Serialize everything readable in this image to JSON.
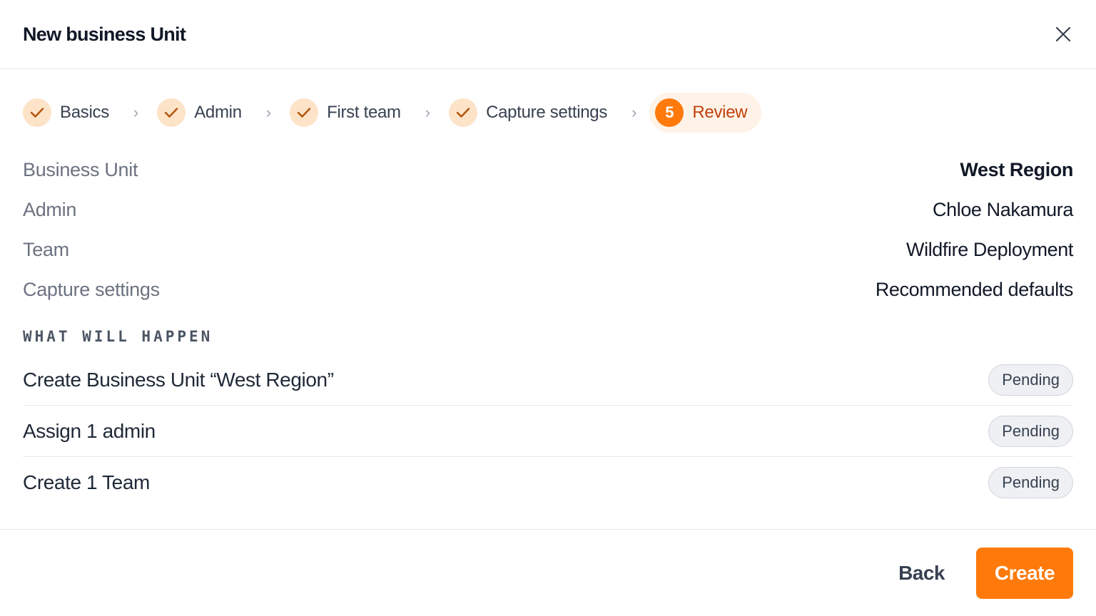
{
  "modal": {
    "title": "New business Unit",
    "close_icon": "close-icon"
  },
  "stepper": {
    "steps": [
      {
        "label": "Basics",
        "status": "complete",
        "icon": "check-icon"
      },
      {
        "label": "Admin",
        "status": "complete",
        "icon": "check-icon"
      },
      {
        "label": "First team",
        "status": "complete",
        "icon": "check-icon"
      },
      {
        "label": "Capture settings",
        "status": "complete",
        "icon": "check-icon"
      },
      {
        "label": "Review",
        "status": "active",
        "number": "5"
      }
    ],
    "separator": "›"
  },
  "summary": {
    "rows": [
      {
        "key": "Business Unit",
        "value": "West Region"
      },
      {
        "key": "Admin",
        "value": "Chloe Nakamura"
      },
      {
        "key": "Team",
        "value": "Wildfire Deployment"
      },
      {
        "key": "Capture settings",
        "value": "Recommended defaults"
      }
    ]
  },
  "what_will_happen": {
    "title": "WHAT WILL HAPPEN",
    "items": [
      {
        "text": "Create Business Unit “West Region”",
        "status": "Pending"
      },
      {
        "text": "Assign 1 admin",
        "status": "Pending"
      },
      {
        "text": "Create 1 Team",
        "status": "Pending"
      }
    ]
  },
  "footer": {
    "back_label": "Back",
    "create_label": "Create"
  },
  "colors": {
    "accent": "#ff7a0a",
    "accent_light": "#fde3c8",
    "check": "#b45309"
  }
}
